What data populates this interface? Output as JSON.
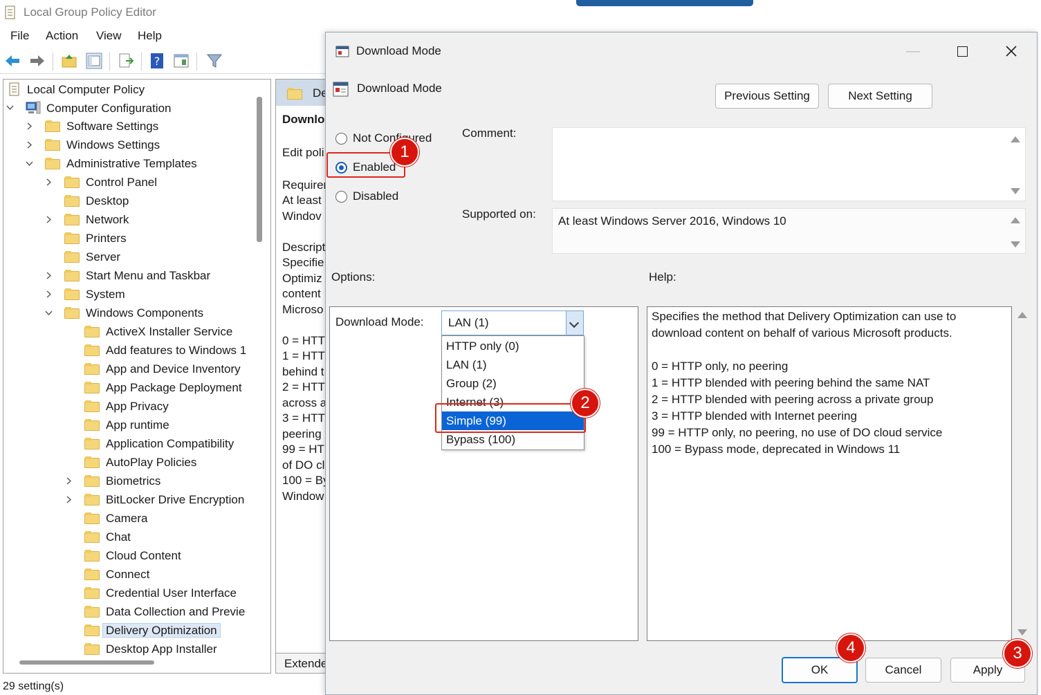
{
  "app": {
    "title": "Local Group Policy Editor"
  },
  "menu": [
    "File",
    "Action",
    "View",
    "Help"
  ],
  "tree": {
    "root": "Local Computer Policy",
    "items": [
      {
        "label": "Computer Configuration"
      },
      {
        "label": "Software Settings"
      },
      {
        "label": "Windows Settings"
      },
      {
        "label": "Administrative Templates"
      },
      {
        "label": "Control Panel"
      },
      {
        "label": "Desktop"
      },
      {
        "label": "Network"
      },
      {
        "label": "Printers"
      },
      {
        "label": "Server"
      },
      {
        "label": "Start Menu and Taskbar"
      },
      {
        "label": "System"
      },
      {
        "label": "Windows Components"
      },
      {
        "label": "ActiveX Installer Service"
      },
      {
        "label": "Add features to Windows 1"
      },
      {
        "label": "App and Device Inventory"
      },
      {
        "label": "App Package Deployment"
      },
      {
        "label": "App Privacy"
      },
      {
        "label": "App runtime"
      },
      {
        "label": "Application Compatibility"
      },
      {
        "label": "AutoPlay Policies"
      },
      {
        "label": "Biometrics"
      },
      {
        "label": "BitLocker Drive Encryption"
      },
      {
        "label": "Camera"
      },
      {
        "label": "Chat"
      },
      {
        "label": "Cloud Content"
      },
      {
        "label": "Connect"
      },
      {
        "label": "Credential User Interface"
      },
      {
        "label": "Data Collection and Previe"
      },
      {
        "label": "Delivery Optimization"
      },
      {
        "label": "Desktop App Installer"
      }
    ]
  },
  "right_pane": {
    "header": "De",
    "lines": [
      "Downlo",
      "Edit poli",
      "Requirer",
      "At least",
      "Windov",
      "Descript",
      "Specifie",
      "Optimiz",
      "content",
      "Microso",
      "0 = HTT",
      "1 = HTT",
      "behind t",
      "2 = HTT",
      "across a",
      "3 = HTT",
      "peering",
      "99 = HT",
      "of DO cl",
      "100 = By",
      "Window"
    ],
    "tab": "Extende"
  },
  "status": "29 setting(s)",
  "dialog": {
    "title": "Download Mode",
    "setting_name": "Download Mode",
    "prev_button": "Previous Setting",
    "next_button": "Next Setting",
    "radio": {
      "not_configured": "Not Configured",
      "enabled": "Enabled",
      "disabled": "Disabled",
      "selected": "enabled"
    },
    "comment_label": "Comment:",
    "comment_value": "",
    "supported_label": "Supported on:",
    "supported_value": "At least Windows Server 2016, Windows 10",
    "options_label": "Options:",
    "help_label": "Help:",
    "download_mode_label": "Download Mode:",
    "download_mode_value": "LAN (1)",
    "dropdown_options": [
      "HTTP only (0)",
      "LAN (1)",
      "Group (2)",
      "Internet (3)",
      "Simple (99)",
      "Bypass (100)"
    ],
    "highlighted_option": "Simple (99)",
    "help_lines": [
      "Specifies the method that Delivery Optimization can use to",
      "download content on behalf of various Microsoft products.",
      "",
      "0 = HTTP only, no peering",
      "1 = HTTP blended with peering behind the same NAT",
      "2 = HTTP blended with peering across a private group",
      "3 = HTTP blended with Internet peering",
      "99 = HTTP only, no peering, no use of DO cloud service",
      "100 = Bypass mode, deprecated in Windows 11"
    ],
    "ok_button": "OK",
    "cancel_button": "Cancel",
    "apply_button": "Apply"
  },
  "callouts": [
    "1",
    "2",
    "3",
    "4"
  ],
  "colors": {
    "accent": "#1a73c8",
    "callout": "#d7150d",
    "selection": "#0b64d6"
  }
}
